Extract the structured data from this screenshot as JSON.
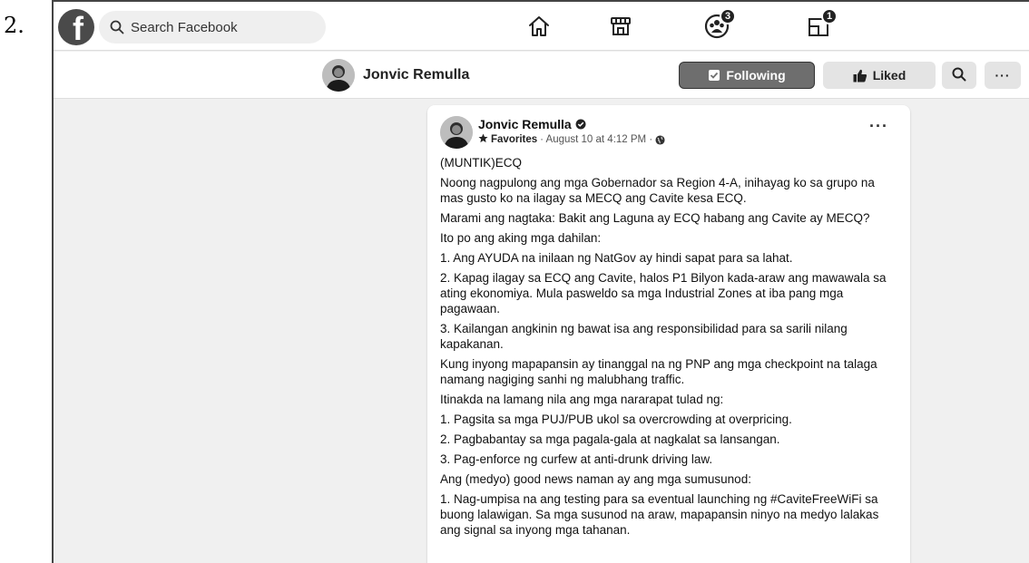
{
  "item_number": "2.",
  "topnav": {
    "search_placeholder": "Search Facebook",
    "icons": [
      "facebook-logo",
      "home-icon",
      "marketplace-icon",
      "groups-icon",
      "gaming-icon"
    ],
    "groups_badge": "3",
    "gaming_badge": "1"
  },
  "profile": {
    "name": "Jonvic Remulla",
    "following_label": "Following",
    "liked_label": "Liked",
    "more_label": "···"
  },
  "post": {
    "author": "Jonvic Remulla",
    "favorites": "Favorites",
    "timestamp": "· August 10 at 4:12 PM ·",
    "more": "···",
    "paragraphs": [
      "(MUNTIK)ECQ",
      "Noong nagpulong ang mga Gobernador sa Region 4-A, inihayag ko sa grupo na mas gusto ko na ilagay sa MECQ ang Cavite kesa ECQ.",
      "Marami ang nagtaka: Bakit ang Laguna ay ECQ habang ang Cavite ay MECQ?",
      "Ito po ang aking mga dahilan:",
      "1. Ang AYUDA na inilaan ng NatGov ay hindi sapat para sa lahat.",
      "2. Kapag ilagay sa ECQ ang Cavite, halos P1 Bilyon kada-araw ang mawawala sa ating ekonomiya. Mula pasweldo sa mga Industrial Zones at iba pang mga pagawaan.",
      "3. Kailangan angkinin ng bawat isa ang responsibilidad para sa sarili nilang kapakanan.",
      "Kung inyong mapapansin ay tinanggal na ng PNP ang mga checkpoint na talaga namang nagiging sanhi ng malubhang traffic.",
      "Itinakda na lamang nila ang mga nararapat tulad ng:",
      "1. Pagsita sa mga PUJ/PUB ukol sa overcrowding at overpricing.",
      "2. Pagbabantay sa mga pagala-gala at nagkalat sa lansangan.",
      "3. Pag-enforce ng curfew at anti-drunk driving law.",
      "Ang (medyo) good news naman ay ang mga sumusunod:",
      "1. Nag-umpisa na ang testing para sa eventual launching ng #CaviteFreeWiFi sa buong lalawigan. Sa mga susunod na araw, mapapansin ninyo na medyo lalakas ang signal sa inyong mga tahanan."
    ]
  }
}
